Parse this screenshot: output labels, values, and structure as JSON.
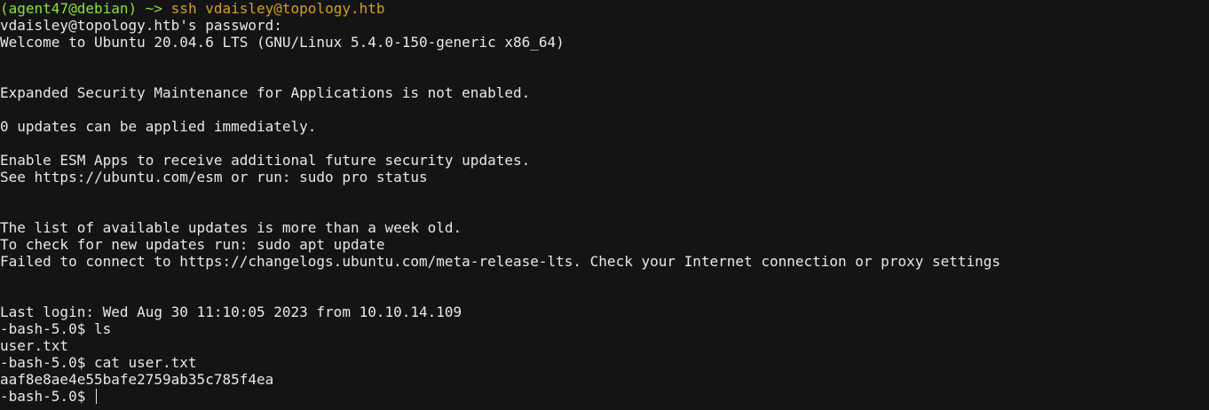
{
  "prompt": {
    "open_paren": "(",
    "userhost": "agent47@debian",
    "close_paren": ")",
    "tilde": " ~> ",
    "command": "ssh vdaisley@topology.htb"
  },
  "lines": [
    "vdaisley@topology.htb's password:",
    "Welcome to Ubuntu 20.04.6 LTS (GNU/Linux 5.4.0-150-generic x86_64)",
    "",
    "",
    "Expanded Security Maintenance for Applications is not enabled.",
    "",
    "0 updates can be applied immediately.",
    "",
    "Enable ESM Apps to receive additional future security updates.",
    "See https://ubuntu.com/esm or run: sudo pro status",
    "",
    "",
    "The list of available updates is more than a week old.",
    "To check for new updates run: sudo apt update",
    "Failed to connect to https://changelogs.ubuntu.com/meta-release-lts. Check your Internet connection or proxy settings",
    "",
    "",
    "Last login: Wed Aug 30 11:10:05 2023 from 10.10.14.109",
    "-bash-5.0$ ls",
    "user.txt",
    "-bash-5.0$ cat user.txt",
    "aaf8e8ae4e55bafe2759ab35c785f4ea"
  ],
  "final_prompt": "-bash-5.0$ ",
  "colors": {
    "background": "#141414",
    "foreground": "#e8e8e8",
    "prompt_green": "#8ae234",
    "command_yellow": "#d4a017"
  }
}
